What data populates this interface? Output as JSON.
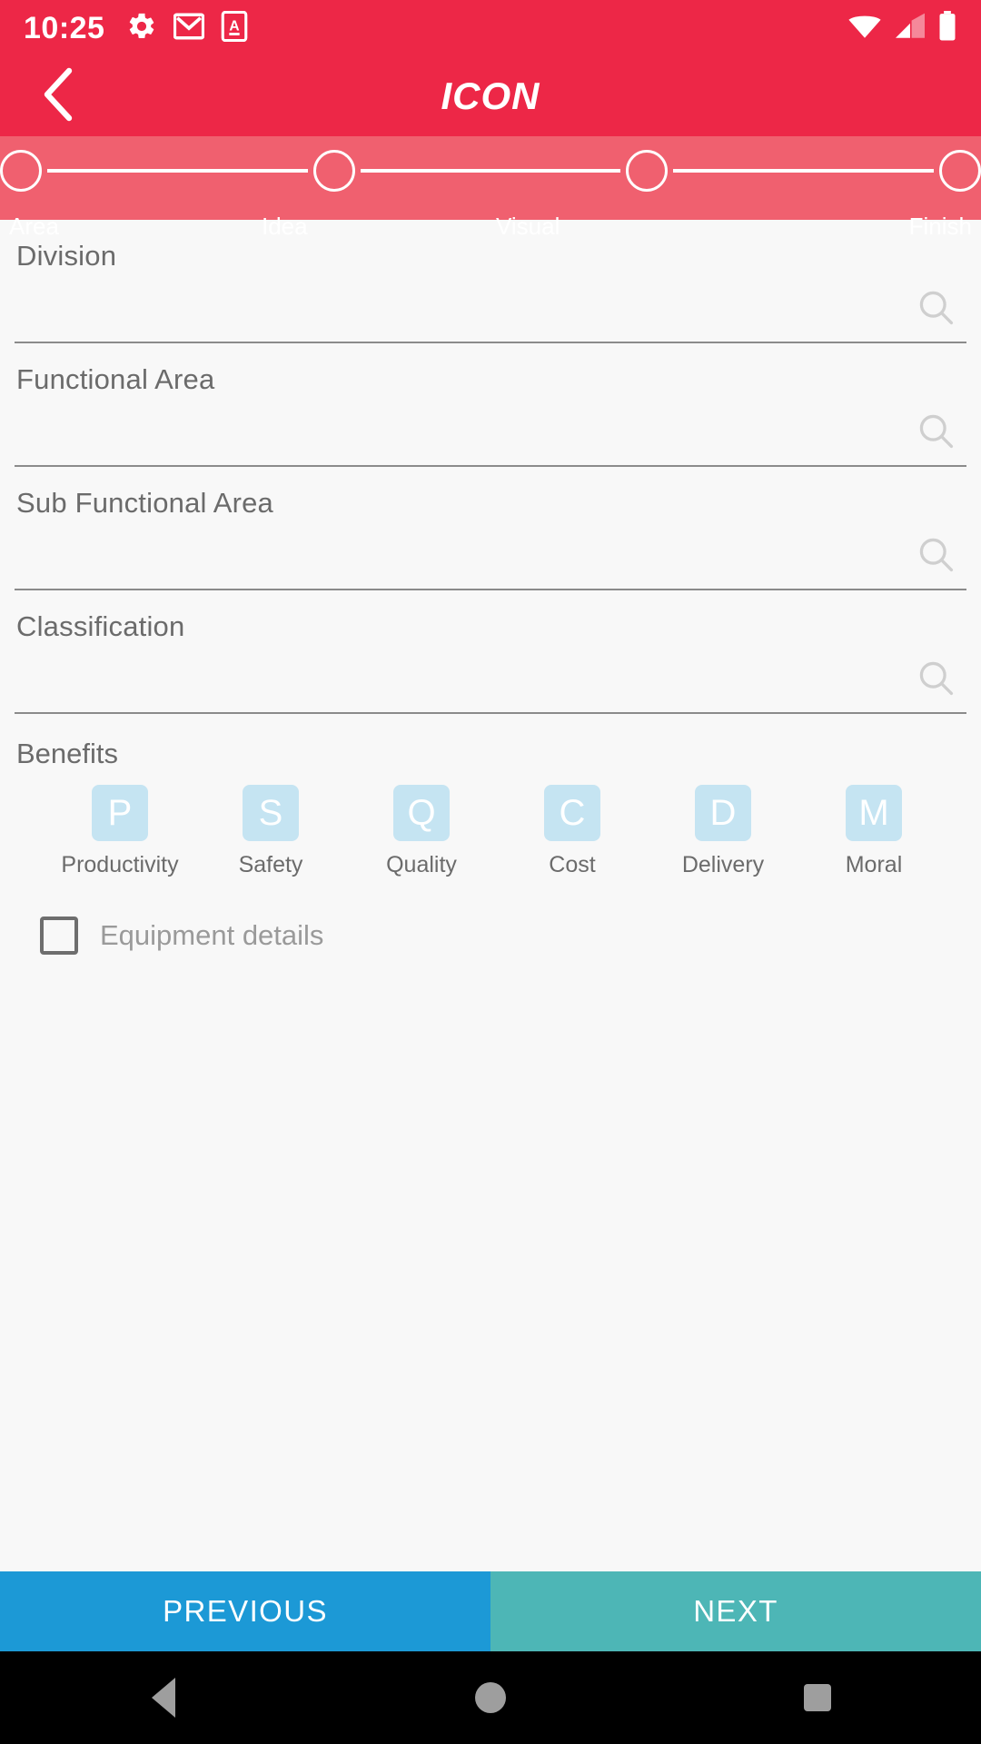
{
  "status_bar": {
    "time": "10:25",
    "left_icons": [
      "gear-icon",
      "gmail-icon",
      "app-a-icon"
    ],
    "right_icons": [
      "wifi-icon",
      "cellular-signal-icon",
      "battery-icon"
    ],
    "background_color": "#ED2747",
    "foreground_color": "#FFFFFF"
  },
  "app_bar": {
    "title": "ICON",
    "back_icon": "chevron-left-icon",
    "background_color": "#ED2747"
  },
  "stepper": {
    "background_color": "#F0606F",
    "steps": [
      {
        "label": "Area"
      },
      {
        "label": "Idea"
      },
      {
        "label": "Visual"
      },
      {
        "label": "Finish"
      }
    ]
  },
  "form": {
    "fields": [
      {
        "label": "Division",
        "value": "",
        "placeholder": "",
        "trailing_icon": "search-icon"
      },
      {
        "label": "Functional Area",
        "value": "",
        "placeholder": "",
        "trailing_icon": "search-icon"
      },
      {
        "label": "Sub Functional Area",
        "value": "",
        "placeholder": "",
        "trailing_icon": "search-icon"
      },
      {
        "label": "Classification",
        "value": "",
        "placeholder": "",
        "trailing_icon": "search-icon"
      }
    ]
  },
  "benefits": {
    "label": "Benefits",
    "badge_color": "#C5E4F2",
    "items": [
      {
        "initial": "P",
        "name": "Productivity"
      },
      {
        "initial": "S",
        "name": "Safety"
      },
      {
        "initial": "Q",
        "name": "Quality"
      },
      {
        "initial": "C",
        "name": "Cost"
      },
      {
        "initial": "D",
        "name": "Delivery"
      },
      {
        "initial": "M",
        "name": "Moral"
      }
    ]
  },
  "equipment_details": {
    "label": "Equipment details",
    "checked": false
  },
  "footer": {
    "previous_label": "PREVIOUS",
    "next_label": "NEXT",
    "previous_color": "#1C99D6",
    "next_color": "#4DB6B6"
  },
  "nav_bar": {
    "back_icon": "triangle-back-icon",
    "home_icon": "circle-home-icon",
    "recents_icon": "square-recents-icon"
  }
}
